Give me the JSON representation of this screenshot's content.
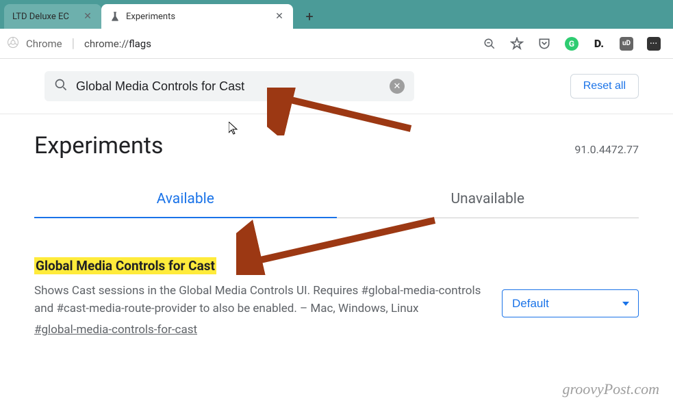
{
  "tabs": {
    "inactive": {
      "title": "LTD Deluxe EC"
    },
    "active": {
      "title": "Experiments"
    }
  },
  "toolbar": {
    "chrome_label": "Chrome",
    "url_scheme": "chrome://",
    "url_path": "flags"
  },
  "search": {
    "value": "Global Media Controls for Cast",
    "reset_label": "Reset all"
  },
  "page": {
    "title": "Experiments",
    "version": "91.0.4472.77",
    "tab_available": "Available",
    "tab_unavailable": "Unavailable"
  },
  "flag": {
    "title": "Global Media Controls for Cast",
    "description": "Shows Cast sessions in the Global Media Controls UI. Requires #global-media-controls and #cast-media-route-provider to also be enabled. – Mac, Windows, Linux",
    "id": "#global-media-controls-for-cast",
    "select_value": "Default"
  },
  "watermark": "groovyPost.com",
  "colors": {
    "arrow": "#9c3813",
    "accent": "#1a73e8",
    "highlight": "#ffeb3b",
    "tabstrip": "#4b9b98"
  }
}
